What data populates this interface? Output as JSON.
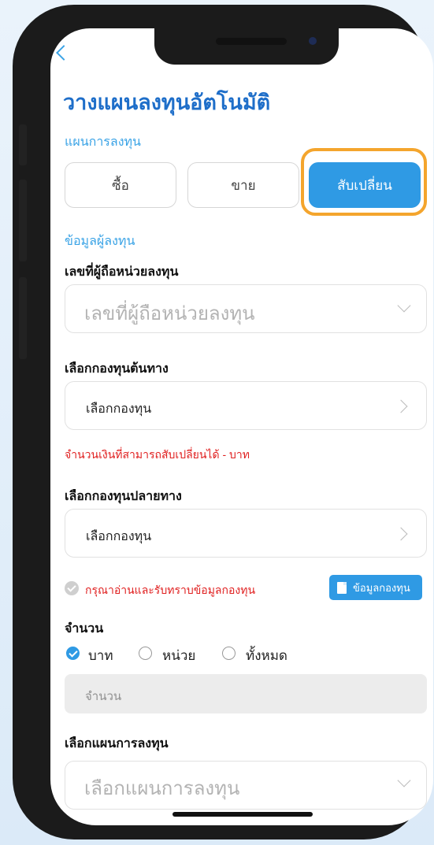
{
  "header": {
    "title": "วางแผนลงทุนอัตโนมัติ"
  },
  "plan_section": {
    "label": "แผนการลงทุน",
    "tabs": [
      "ซื้อ",
      "ขาย",
      "สับเปลี่ยน"
    ],
    "active_tab": "สับเปลี่ยน"
  },
  "investor": {
    "section_label": "ข้อมูลผู้ลงทุน",
    "holder_label": "เลขที่ผู้ถือหน่วยลงทุน",
    "holder_placeholder": "เลขที่ผู้ถือหน่วยลงทุน"
  },
  "source_fund": {
    "label": "เลือกกองทุนต้นทาง",
    "value": "เลือกกองทุน",
    "switch_amount_note": "จำนวนเงินที่สามารถสับเปลี่ยนได้ - บาท"
  },
  "dest_fund": {
    "label": "เลือกกองทุนปลายทาง",
    "value": "เลือกกองทุน"
  },
  "fund_info": {
    "ack_text": "กรุณาอ่านและรับทราบข้อมูลกองทุน",
    "button_label": "ข้อมูลกองทุน"
  },
  "amount": {
    "label": "จำนวน",
    "options": [
      "บาท",
      "หน่วย",
      "ทั้งหมด"
    ],
    "selected": "บาท",
    "placeholder": "จำนวน"
  },
  "plan_select": {
    "label": "เลือกแผนการลงทุน",
    "placeholder": "เลือกแผนการลงทุน"
  },
  "colors": {
    "accent": "#2f9ae4",
    "title": "#1e6ec9",
    "highlight": "#f4a52d",
    "warning": "#e02020"
  }
}
